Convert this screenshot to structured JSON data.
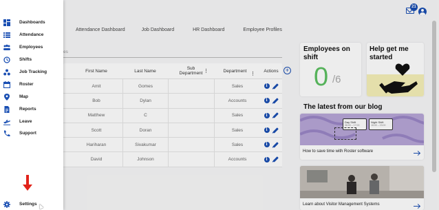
{
  "header": {
    "mail_badge": "21"
  },
  "tabs": [
    "Attendance Dashboard",
    "Job Dashboard",
    "HR Dashboard",
    "Employee Profiles"
  ],
  "search_partial": "es",
  "table": {
    "headers": {
      "first_name": "First Name",
      "last_name": "Last Name",
      "sub_department": "Sub Department",
      "department": "Department",
      "actions": "Actions"
    },
    "rows": [
      {
        "first": "Amit",
        "last": "Gomes",
        "sub": "",
        "dept": "Sales"
      },
      {
        "first": "Bob",
        "last": "Dylan",
        "sub": "",
        "dept": "Accounts"
      },
      {
        "first": "Matthew",
        "last": "C",
        "sub": "",
        "dept": "Sales"
      },
      {
        "first": "Scott",
        "last": "Doran",
        "sub": "",
        "dept": "Sales"
      },
      {
        "first": "Hariharan",
        "last": "Sivakumar",
        "sub": "",
        "dept": "Sales"
      },
      {
        "first": "David",
        "last": "Johnson",
        "sub": "",
        "dept": "Accounts"
      }
    ],
    "add_column": "+"
  },
  "cards": {
    "employees_on_shift": {
      "title": "Employees on shift",
      "count": "0",
      "total": "/6"
    },
    "help": {
      "title": "Help get me started"
    }
  },
  "blog": {
    "title": "The latest from our blog",
    "posts": [
      {
        "caption": "How to save time with Roster software",
        "shift_cards": [
          {
            "label": "Day Shift",
            "time": "08:00 – 17:00"
          },
          {
            "label": "Night Shift",
            "time": "18:00 – 23:00"
          }
        ]
      },
      {
        "caption": "Learn about Visitor Management Systems"
      }
    ]
  },
  "sidebar": {
    "items": [
      {
        "label": "Dashboards",
        "icon": "dashboard-icon"
      },
      {
        "label": "Attendance",
        "icon": "list-icon"
      },
      {
        "label": "Employees",
        "icon": "people-icon"
      },
      {
        "label": "Shifts",
        "icon": "clock-icon"
      },
      {
        "label": "Job Tracking",
        "icon": "nodes-icon"
      },
      {
        "label": "Roster",
        "icon": "calendar-icon"
      },
      {
        "label": "Map",
        "icon": "map-pin-icon"
      },
      {
        "label": "Reports",
        "icon": "document-icon"
      },
      {
        "label": "Leave",
        "icon": "plane-icon"
      },
      {
        "label": "Support",
        "icon": "phone-icon"
      }
    ],
    "settings": {
      "label": "Settings",
      "icon": "gear-icon"
    }
  },
  "colors": {
    "accent": "#1a4fb3",
    "success": "#5cc061",
    "annotation_arrow": "#e2231a"
  }
}
